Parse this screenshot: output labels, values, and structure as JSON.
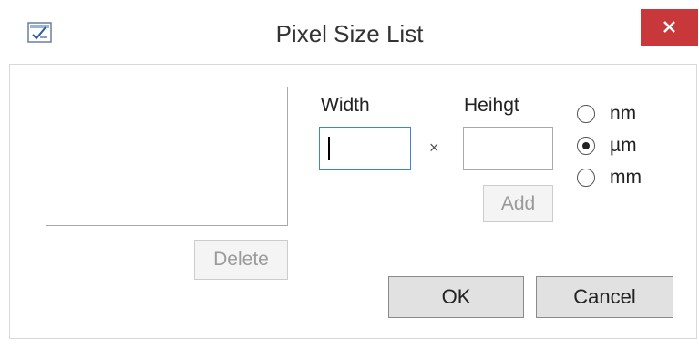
{
  "window": {
    "title": "Pixel Size List",
    "close_label": "×",
    "accent_close": "#c8373a"
  },
  "list": {
    "items": []
  },
  "buttons": {
    "delete_label": "Delete",
    "add_label": "Add",
    "ok_label": "OK",
    "cancel_label": "Cancel"
  },
  "size": {
    "width_label": "Width",
    "height_label": "Heihgt",
    "width_value": "",
    "height_value": "",
    "separator": "×"
  },
  "units": {
    "options": [
      {
        "label": "nm",
        "selected": false
      },
      {
        "label": "µm",
        "selected": true
      },
      {
        "label": "mm",
        "selected": false
      }
    ]
  },
  "icons": {
    "app": "checklist-icon",
    "close": "close-icon"
  }
}
